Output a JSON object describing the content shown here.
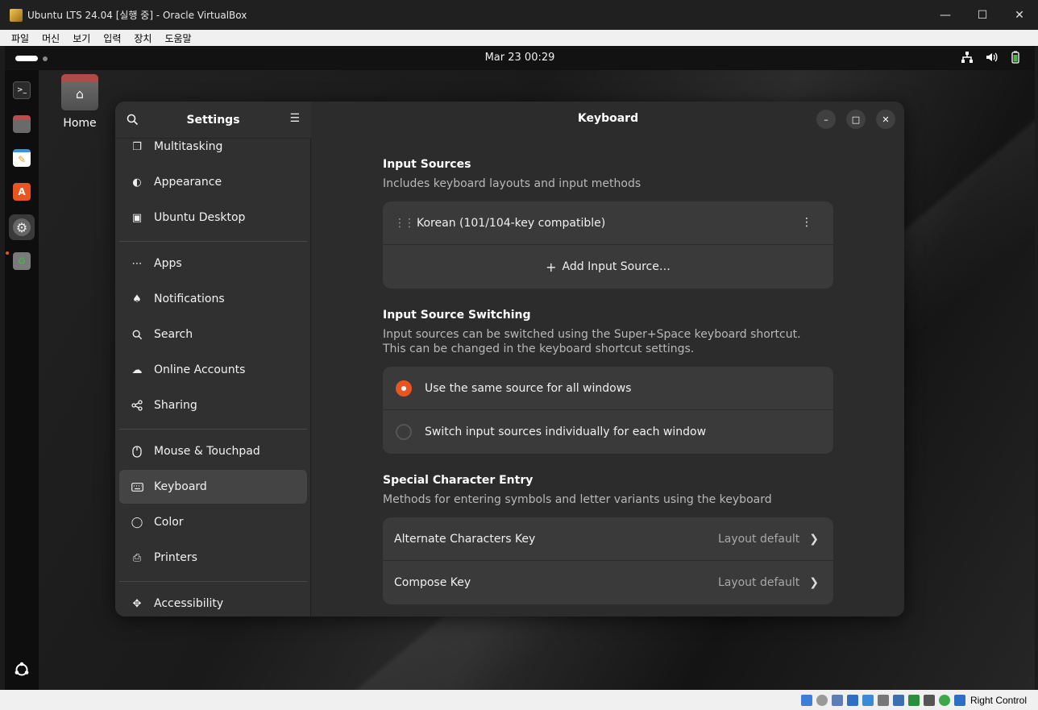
{
  "host": {
    "window_title": "Ubuntu LTS 24.04 [실행 중] - Oracle VirtualBox",
    "menu": [
      "파일",
      "머신",
      "보기",
      "입력",
      "장치",
      "도움말"
    ],
    "status_text": "Right Control"
  },
  "guest": {
    "clock": "Mar 23  00:29",
    "desktop": {
      "home_label": "Home"
    }
  },
  "settings": {
    "sidebar_title": "Settings",
    "page_title": "Keyboard",
    "sidebar_items": [
      {
        "label": "Multitasking"
      },
      {
        "label": "Appearance"
      },
      {
        "label": "Ubuntu Desktop"
      },
      {
        "label": "Apps"
      },
      {
        "label": "Notifications"
      },
      {
        "label": "Search"
      },
      {
        "label": "Online Accounts"
      },
      {
        "label": "Sharing"
      },
      {
        "label": "Mouse & Touchpad"
      },
      {
        "label": "Keyboard"
      },
      {
        "label": "Color"
      },
      {
        "label": "Printers"
      },
      {
        "label": "Accessibility"
      }
    ],
    "input_sources": {
      "title": "Input Sources",
      "desc": "Includes keyboard layouts and input methods",
      "items": [
        "Korean (101/104-key compatible)"
      ],
      "add_label": "Add Input Source…"
    },
    "switching": {
      "title": "Input Source Switching",
      "desc1": "Input sources can be switched using the Super+Space keyboard shortcut.",
      "desc2": "This can be changed in the keyboard shortcut settings.",
      "options": [
        {
          "label": "Use the same source for all windows",
          "selected": true
        },
        {
          "label": "Switch input sources individually for each window",
          "selected": false
        }
      ]
    },
    "special": {
      "title": "Special Character Entry",
      "desc": "Methods for entering symbols and letter variants using the keyboard",
      "rows": [
        {
          "label": "Alternate Characters Key",
          "value": "Layout default"
        },
        {
          "label": "Compose Key",
          "value": "Layout default"
        }
      ]
    }
  },
  "colors": {
    "accent": "#e95420"
  }
}
